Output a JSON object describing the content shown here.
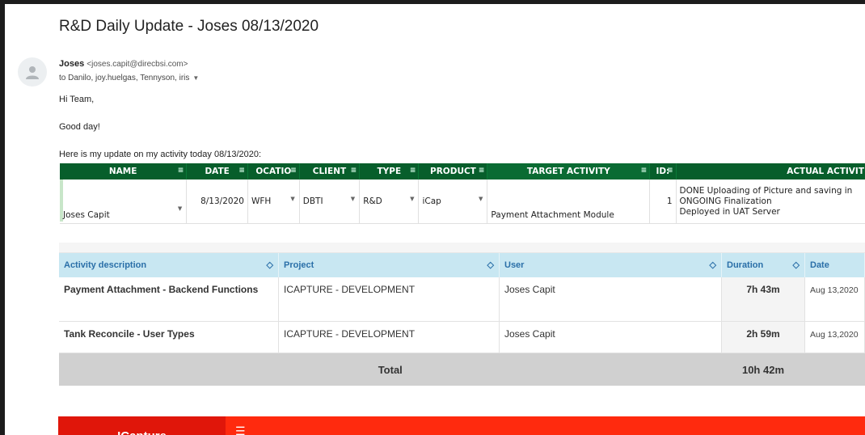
{
  "email": {
    "subject": "R&D Daily Update - Joses 08/13/2020",
    "sender_name": "Joses",
    "sender_email": "<joses.capit@direcbsi.com>",
    "recipients": "to Danilo, joy.huelgas, Tennyson, iris",
    "greeting": "Hi Team,",
    "line2": "Good day!",
    "line3": "Here is my update on my activity today 08/13/2020:"
  },
  "sheet": {
    "headers": [
      "NAME",
      "DATE",
      "OCATIO",
      "CLIENT",
      "TYPE",
      "PRODUCT",
      "TARGET ACTIVITY",
      "ID:",
      "ACTUAL ACTIVIT"
    ],
    "row": {
      "name": "Joses Capit",
      "date": "8/13/2020",
      "location": "WFH",
      "client": "DBTI",
      "type": "R&D",
      "product": "iCap",
      "target": "Payment Attachment Module",
      "id": "1",
      "actual": [
        "DONE Uploading of Picture and saving in",
        "ONGOING Finalization",
        "Deployed in UAT Server"
      ]
    }
  },
  "report": {
    "headers": [
      "Activity description",
      "Project",
      "User",
      "Duration",
      "Date"
    ],
    "rows": [
      {
        "desc": "Payment Attachment - Backend Functions",
        "project": "ICAPTURE - DEVELOPMENT",
        "user": "Joses Capit",
        "duration": "7h 43m",
        "date": "Aug 13,2020"
      },
      {
        "desc": "Tank Reconcile - User Types",
        "project": "ICAPTURE - DEVELOPMENT",
        "user": "Joses Capit",
        "duration": "2h 59m",
        "date": "Aug 13,2020"
      }
    ],
    "total_label": "Total",
    "total_value": "10h 42m"
  },
  "brand": {
    "name": "ICapture",
    "menu_icon": "hamburger-icon"
  },
  "icons": {
    "avatar": "person-icon",
    "filter": "filter-icon",
    "sort": "sort-icon",
    "dropdown": "dropdown-arrow-icon"
  },
  "colors": {
    "sheet_header": "#075e2b",
    "report_header": "#c8e7f2",
    "brand_bar": "#ff2a0e"
  }
}
